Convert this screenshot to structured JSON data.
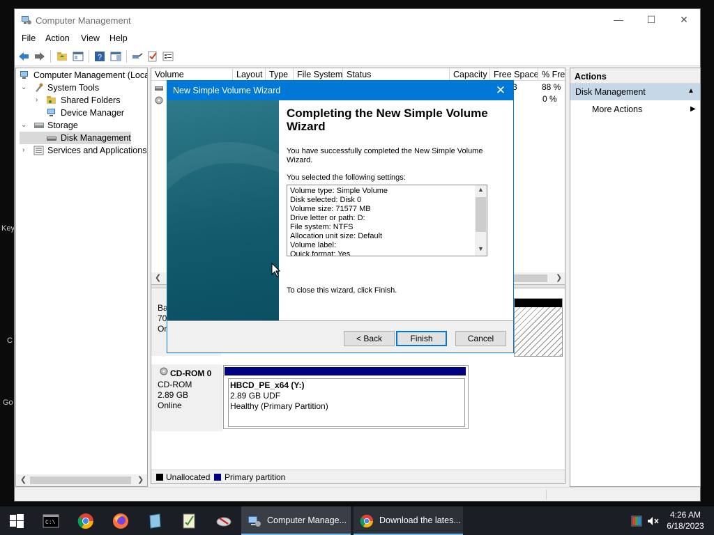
{
  "desktop": {
    "fragments": [
      "Key",
      "C",
      "Go"
    ]
  },
  "window": {
    "title": "Computer Management",
    "controls": {
      "minimize": "—",
      "maximize": "☐",
      "close": "✕"
    },
    "menu": [
      "File",
      "Action",
      "View",
      "Help"
    ]
  },
  "tree": {
    "root": "Computer Management (Local",
    "system_tools": "System Tools",
    "shared_folders": "Shared Folders",
    "device_manager": "Device Manager",
    "storage": "Storage",
    "disk_management": "Disk Management",
    "services": "Services and Applications"
  },
  "volume_list": {
    "columns": [
      "Volume",
      "Layout",
      "Type",
      "File System",
      "Status",
      "Capacity",
      "Free Space",
      "% Free"
    ],
    "partial_values": {
      "row1_free_space_fragment": "3",
      "row1_pct_free": "88 %",
      "row2_pct_free": "0 %"
    }
  },
  "disk0": {
    "fragments": [
      "Ba",
      "70.",
      "On"
    ]
  },
  "cdrom": {
    "name": "CD-ROM 0",
    "type": "CD-ROM",
    "size": "2.89 GB",
    "status": "Online",
    "partition_name": "HBCD_PE_x64  (Y:)",
    "partition_size": "2.89 GB UDF",
    "partition_status": "Healthy (Primary Partition)"
  },
  "legend": {
    "unallocated": "Unallocated",
    "primary": "Primary partition"
  },
  "actions": {
    "header": "Actions",
    "section": "Disk Management",
    "more": "More Actions"
  },
  "dialog": {
    "title": "New Simple Volume Wizard",
    "close": "✕",
    "heading": "Completing the New Simple Volume Wizard",
    "success": "You have successfully completed the New Simple Volume Wizard.",
    "settings_label": "You selected the following settings:",
    "settings": [
      "Volume type: Simple Volume",
      "Disk selected: Disk 0",
      "Volume size: 71577 MB",
      "Drive letter or path: D:",
      "File system: NTFS",
      "Allocation unit size: Default",
      "Volume label:",
      "Quick format: Yes"
    ],
    "close_instruction": "To close this wizard, click Finish.",
    "buttons": {
      "back": "< Back",
      "finish": "Finish",
      "cancel": "Cancel"
    }
  },
  "taskbar": {
    "apps": [
      "Computer Manage...",
      "Download the lates..."
    ],
    "time": "4:26 AM",
    "date": "6/18/2023"
  },
  "colors": {
    "accent": "#0078d7",
    "primary_partition": "#000080",
    "unallocated": "#000000",
    "taskbar": "#1b1e24",
    "actions_section": "#c6d7e8"
  }
}
